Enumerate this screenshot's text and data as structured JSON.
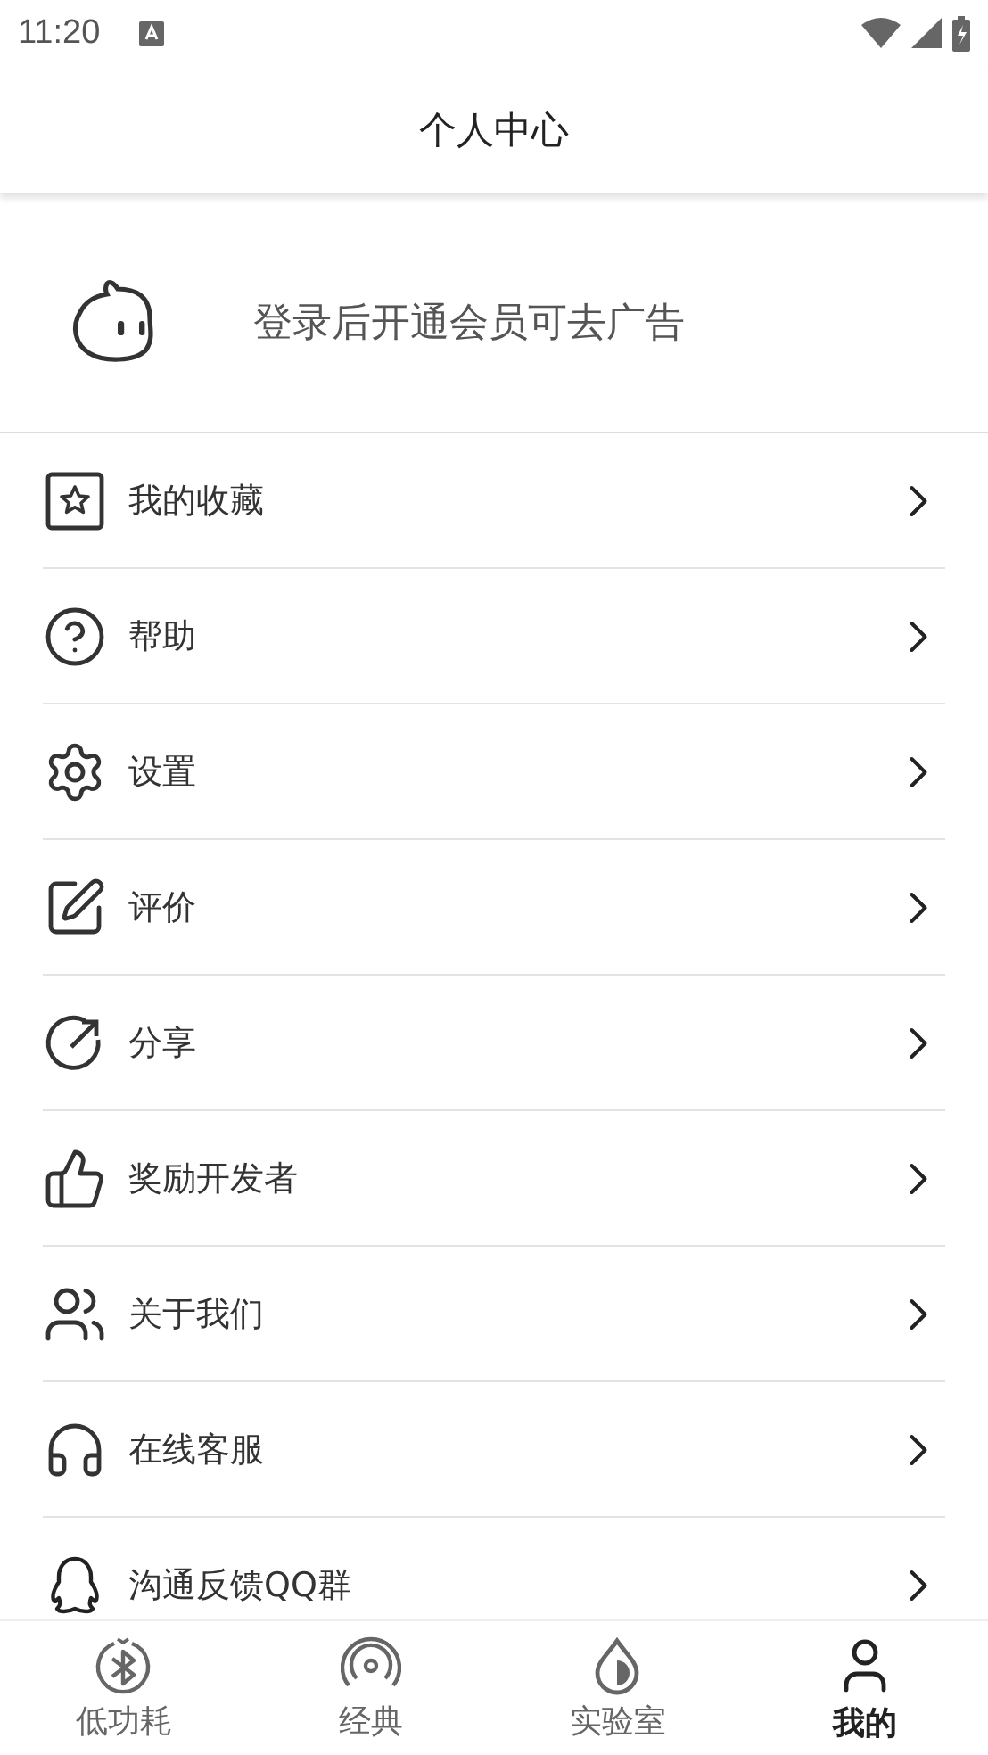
{
  "status_bar": {
    "time": "11:20"
  },
  "header": {
    "title": "个人中心"
  },
  "banner": {
    "text": "登录后开通会员可去广告"
  },
  "menu": [
    {
      "label": "我的收藏"
    },
    {
      "label": "帮助"
    },
    {
      "label": "设置"
    },
    {
      "label": "评价"
    },
    {
      "label": "分享"
    },
    {
      "label": "奖励开发者"
    },
    {
      "label": "关于我们"
    },
    {
      "label": "在线客服"
    },
    {
      "label": "沟通反馈QQ群"
    }
  ],
  "tabs": [
    {
      "label": "低功耗",
      "selected": false
    },
    {
      "label": "经典",
      "selected": false
    },
    {
      "label": "实验室",
      "selected": false
    },
    {
      "label": "我的",
      "selected": true
    }
  ]
}
